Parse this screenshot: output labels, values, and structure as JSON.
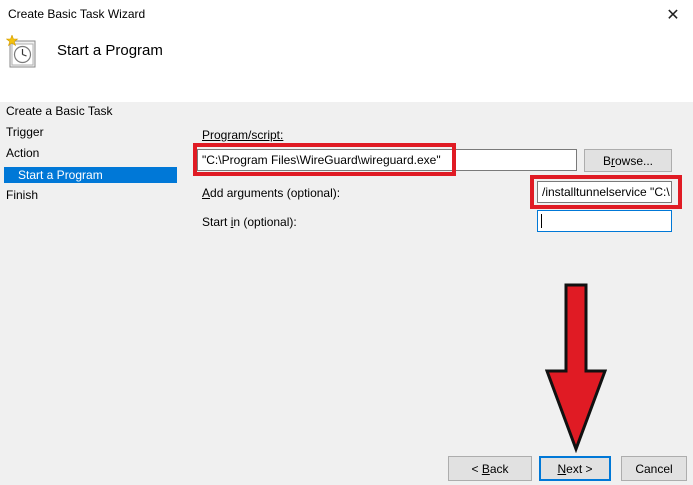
{
  "window": {
    "title": "Create Basic Task Wizard",
    "close_glyph": "✕"
  },
  "header": {
    "icon": "task-clock-icon",
    "title": "Start a Program"
  },
  "sidebar": {
    "items": [
      {
        "label": "Create a Basic Task",
        "selected": false
      },
      {
        "label": "Trigger",
        "selected": false
      },
      {
        "label": "Action",
        "selected": false
      },
      {
        "label": "Start a Program",
        "selected": true
      },
      {
        "label": "Finish",
        "selected": false
      }
    ]
  },
  "form": {
    "program_label": "Program/script:",
    "program_value": "\"C:\\Program Files\\WireGuard\\wireguard.exe\"",
    "browse_label": "Browse...",
    "arguments_label": "Add arguments (optional):",
    "arguments_value": "/installtunnelservice \"C:\\",
    "start_in_label": "Start in (optional):",
    "start_in_value": ""
  },
  "footer": {
    "back_label": "< Back",
    "next_label": "Next >",
    "cancel_label": "Cancel"
  },
  "annotations": {
    "highlight_color": "#e01b24",
    "arrow_color": "#e01b24",
    "arrow_target": "next-button"
  },
  "colors": {
    "selection": "#0078d7",
    "dialog_background": "#f0f0f0"
  }
}
